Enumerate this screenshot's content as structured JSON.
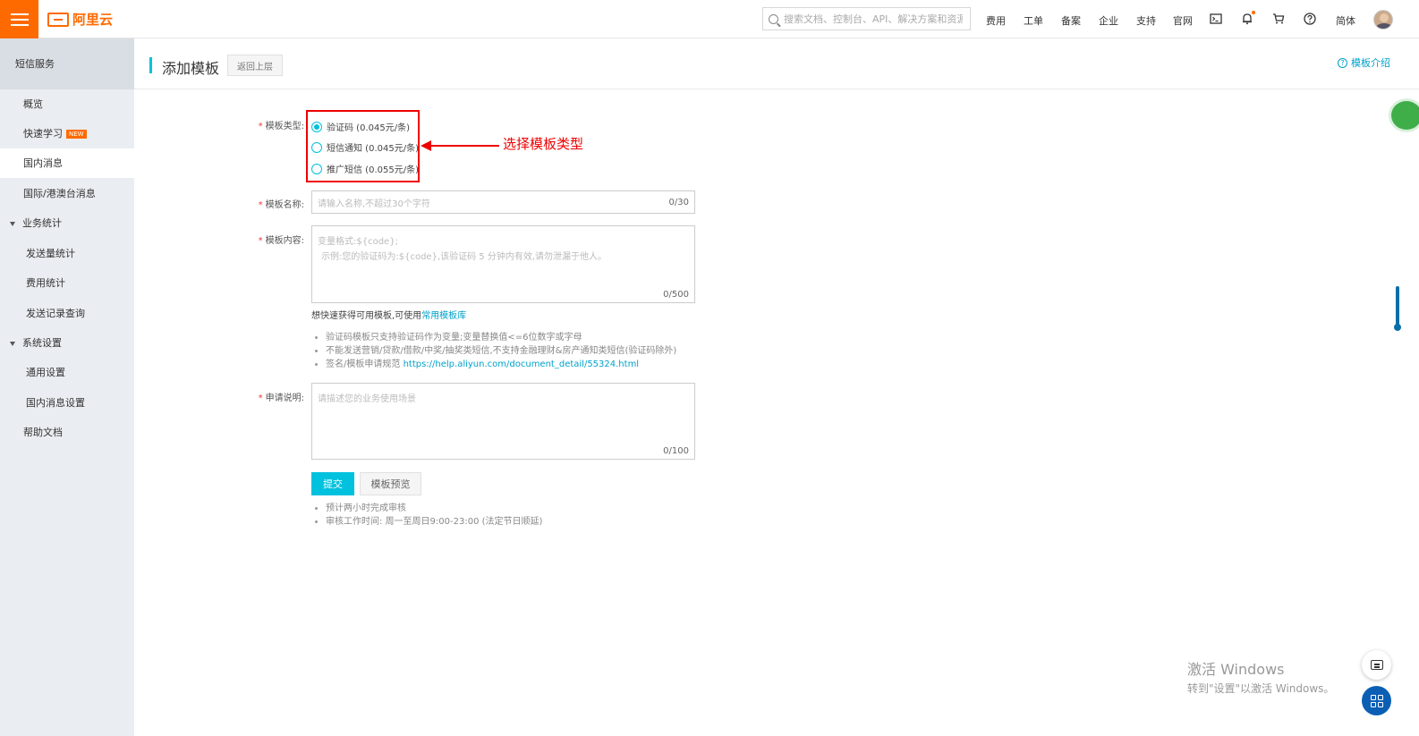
{
  "topbar": {
    "logo_text": "阿里云",
    "search_placeholder": "搜索文档、控制台、API、解决方案和资源",
    "nav": [
      "费用",
      "工单",
      "备案",
      "企业",
      "支持",
      "官网"
    ],
    "lang": "简体"
  },
  "sidebar": {
    "title": "短信服务",
    "items": [
      {
        "label": "概览"
      },
      {
        "label": "快速学习",
        "badge": "NEW"
      },
      {
        "label": "国内消息"
      },
      {
        "label": "国际/港澳台消息"
      },
      {
        "label": "业务统计"
      },
      {
        "label": "发送量统计"
      },
      {
        "label": "费用统计"
      },
      {
        "label": "发送记录查询"
      },
      {
        "label": "系统设置"
      },
      {
        "label": "通用设置"
      },
      {
        "label": "国内消息设置"
      },
      {
        "label": "帮助文档"
      }
    ]
  },
  "header": {
    "title": "添加模板",
    "back_label": "返回上层",
    "intro_label": "模板介绍"
  },
  "form": {
    "type_label": "模板类型:",
    "types": [
      "验证码 (0.045元/条)",
      "短信通知 (0.045元/条)",
      "推广短信 (0.055元/条)"
    ],
    "selected_type": "验证码 (0.045元/条)",
    "annotation": "选择模板类型",
    "name_label": "模板名称:",
    "name_placeholder": "请输入名称,不超过30个字符",
    "name_counter": "0/30",
    "content_label": "模板内容:",
    "content_placeholder_line1": "变量格式:${code};",
    "content_placeholder_line2": "示例:您的验证码为:${code},该验证码 5 分钟内有效,请勿泄漏于他人。",
    "content_counter": "0/500",
    "hint_prefix": "想快速获得可用模板,可使用",
    "hint_link": "常用模板库",
    "rules": [
      "验证码模板只支持验证码作为变量;变量替换值<=6位数字或字母",
      "不能发送营销/贷款/借款/中奖/抽奖类短信,不支持金融理财&房产通知类短信(验证码除外)",
      "签名/模板申请规范"
    ],
    "rules_link": "https://help.aliyun.com/document_detail/55324.html",
    "reason_label": "申请说明:",
    "reason_placeholder": "请描述您的业务使用场景",
    "reason_counter": "0/100",
    "submit_label": "提交",
    "preview_label": "模板预览",
    "notes": [
      "预计两小时完成审核",
      "审核工作时间: 周一至周日9:00-23:00 (法定节日顺延)"
    ]
  },
  "watermark": {
    "line1": "激活 Windows",
    "line2": "转到\"设置\"以激活 Windows。"
  }
}
